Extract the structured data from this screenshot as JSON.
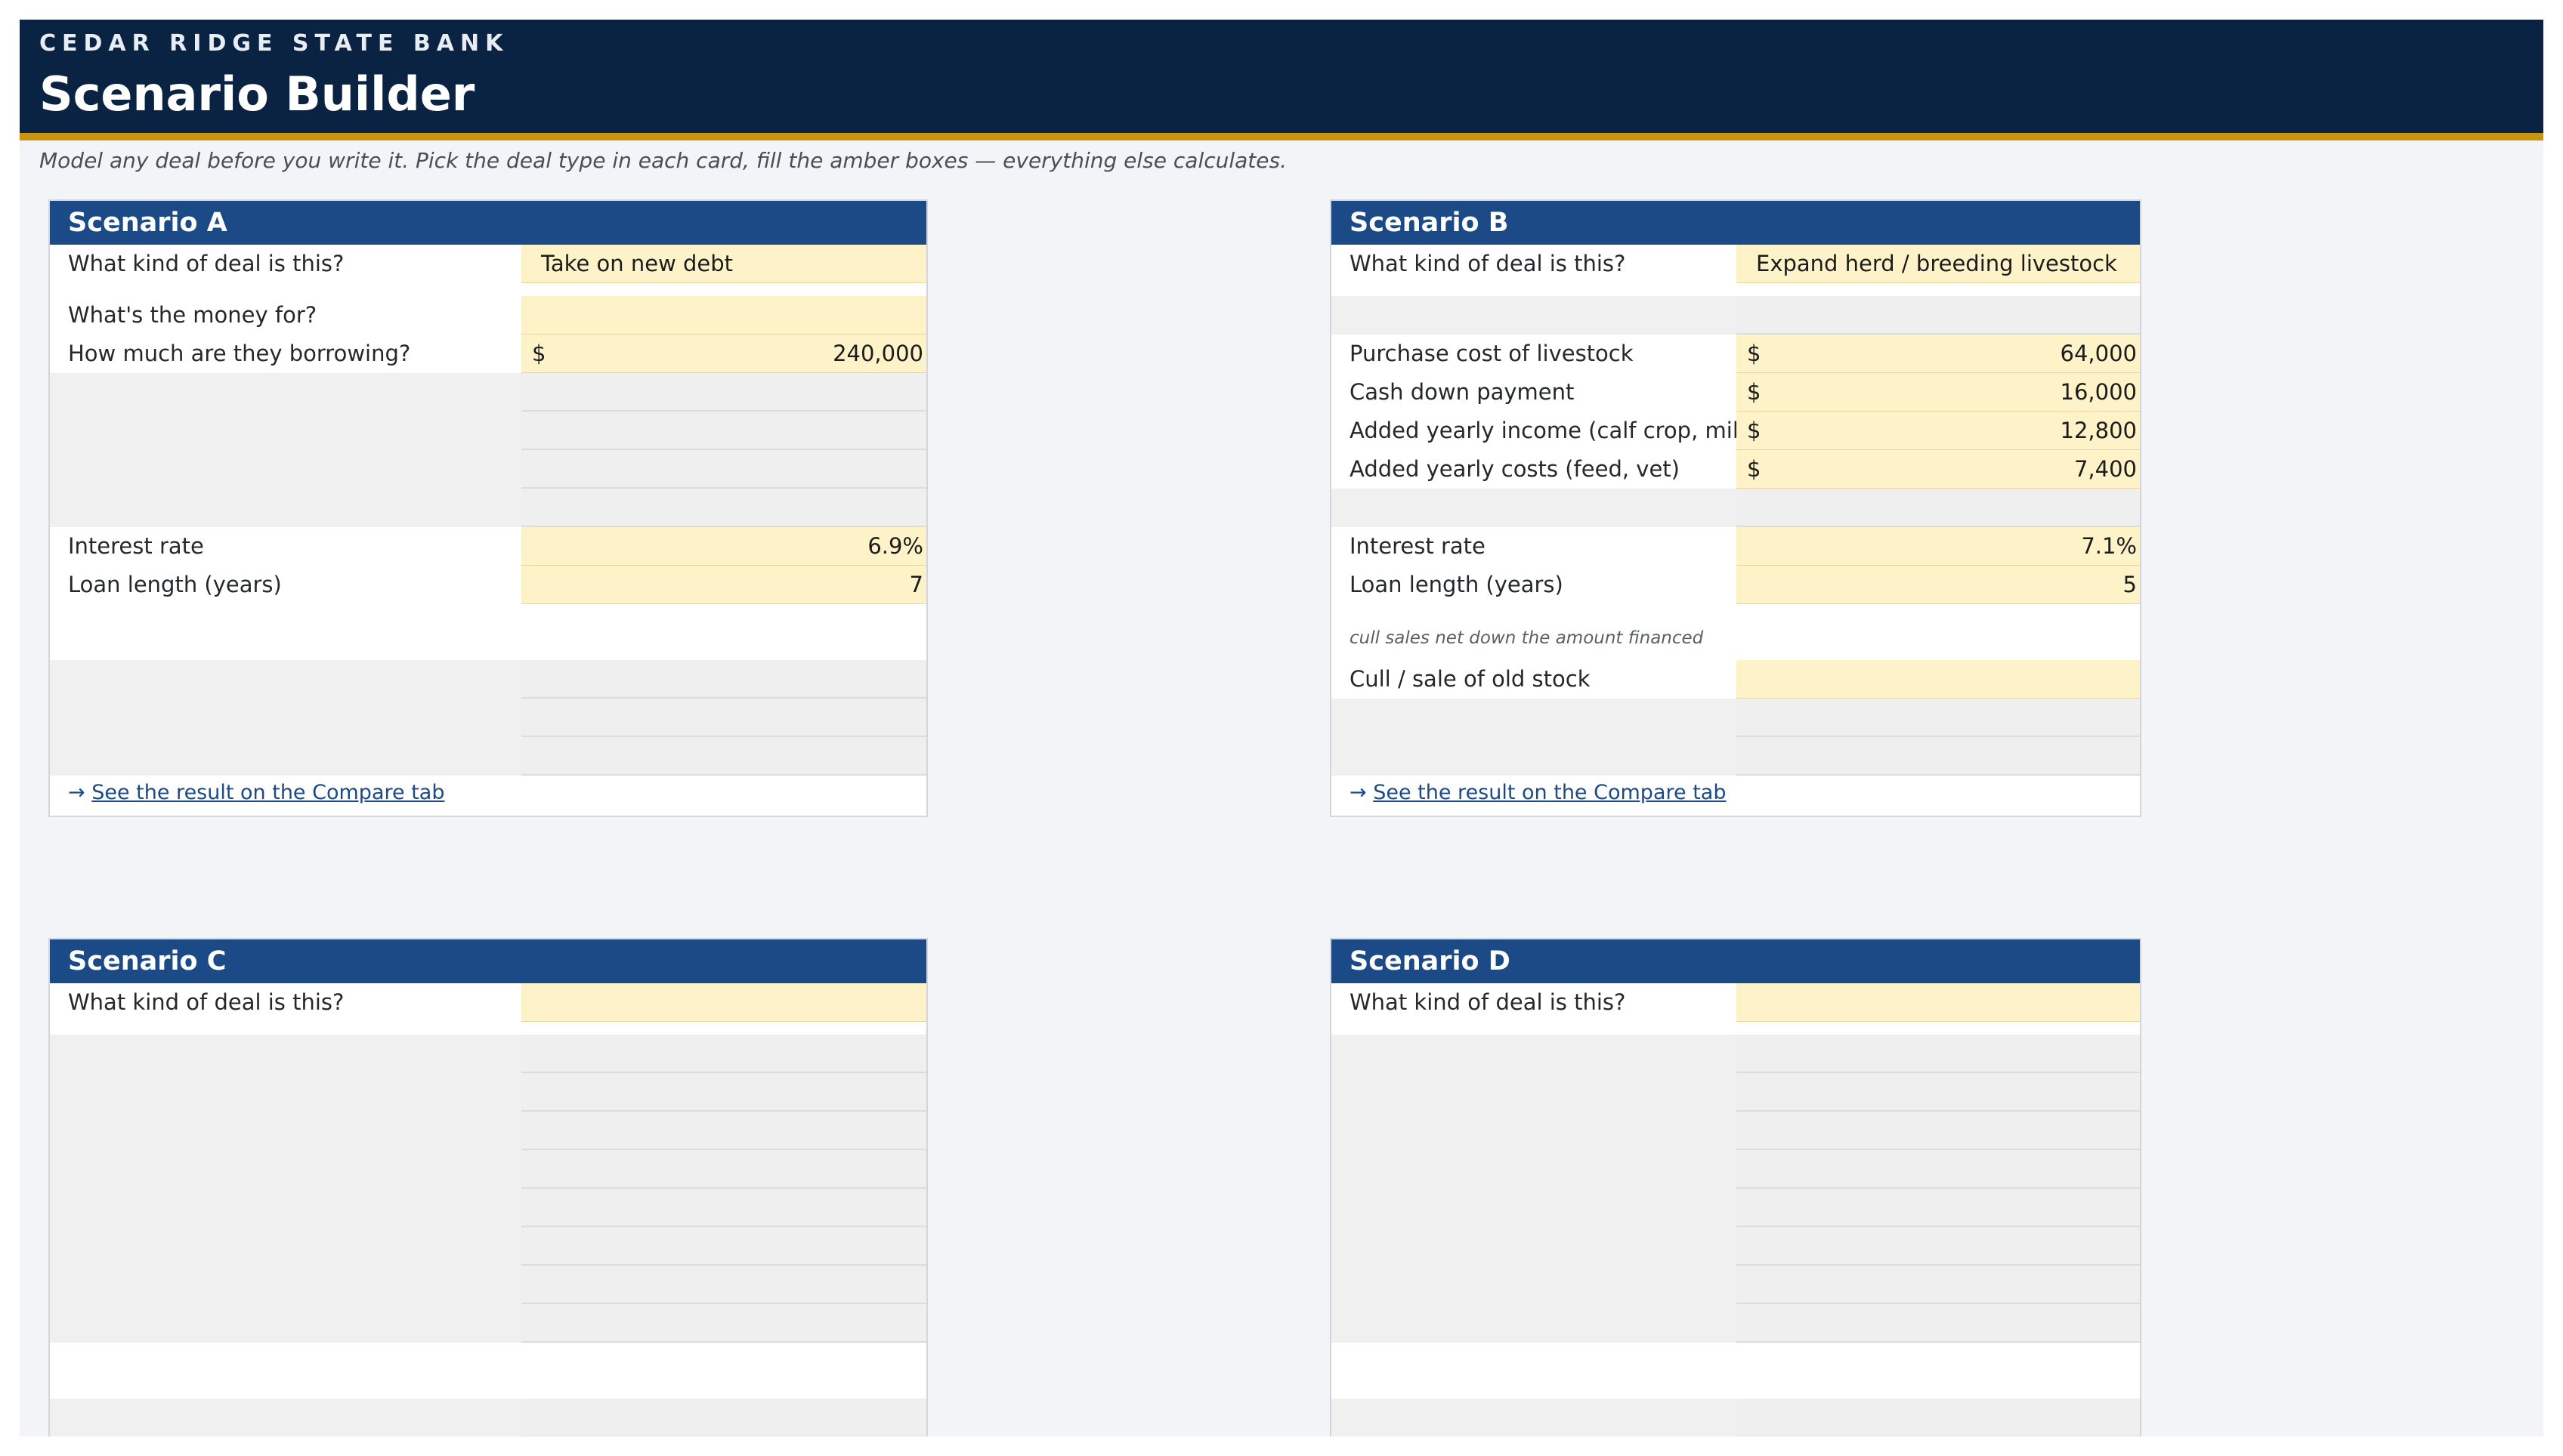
{
  "header": {
    "bank_name": "CEDAR RIDGE STATE BANK",
    "title": "Scenario Builder",
    "subtitle": "Model any deal before you write it. Pick the deal type in each card, fill the amber boxes — everything else calculates."
  },
  "colors": {
    "banner": "#0b2343",
    "accent_bar": "#c9930b",
    "card_header": "#1c4a86",
    "input_fill": "#fef2c8",
    "inactive_fill": "#efefef"
  },
  "icons": {
    "link_arrow": "→"
  },
  "scenario_a": {
    "title": "Scenario A",
    "deal_type_label": "What kind of deal is this?",
    "deal_type_value": "Take on new debt",
    "purpose_label": "What's the money for?",
    "purpose_value": "",
    "amount_label": "How much are they borrowing?",
    "amount_currency": "$",
    "amount_value": "240,000",
    "rate_label": "Interest rate",
    "rate_value": "6.9%",
    "term_label": "Loan length (years)",
    "term_value": "7",
    "compare_link": "See the result on the Compare tab"
  },
  "scenario_b": {
    "title": "Scenario B",
    "deal_type_label": "What kind of deal is this?",
    "deal_type_value": "Expand herd / breeding livestock",
    "purchase_label": "Purchase cost of livestock",
    "purchase_currency": "$",
    "purchase_value": "64,000",
    "down_label": "Cash down payment",
    "down_currency": "$",
    "down_value": "16,000",
    "income_label": "Added yearly income (calf crop, milk)",
    "income_currency": "$",
    "income_value": "12,800",
    "costs_label": "Added yearly costs (feed, vet)",
    "costs_currency": "$",
    "costs_value": "7,400",
    "rate_label": "Interest rate",
    "rate_value": "7.1%",
    "term_label": "Loan length (years)",
    "term_value": "5",
    "cull_note": "cull sales net down the amount financed",
    "cull_label": "Cull / sale of old stock",
    "cull_value": "",
    "compare_link": "See the result on the Compare tab"
  },
  "scenario_c": {
    "title": "Scenario C",
    "deal_type_label": "What kind of deal is this?",
    "deal_type_value": ""
  },
  "scenario_d": {
    "title": "Scenario D",
    "deal_type_label": "What kind of deal is this?",
    "deal_type_value": ""
  }
}
